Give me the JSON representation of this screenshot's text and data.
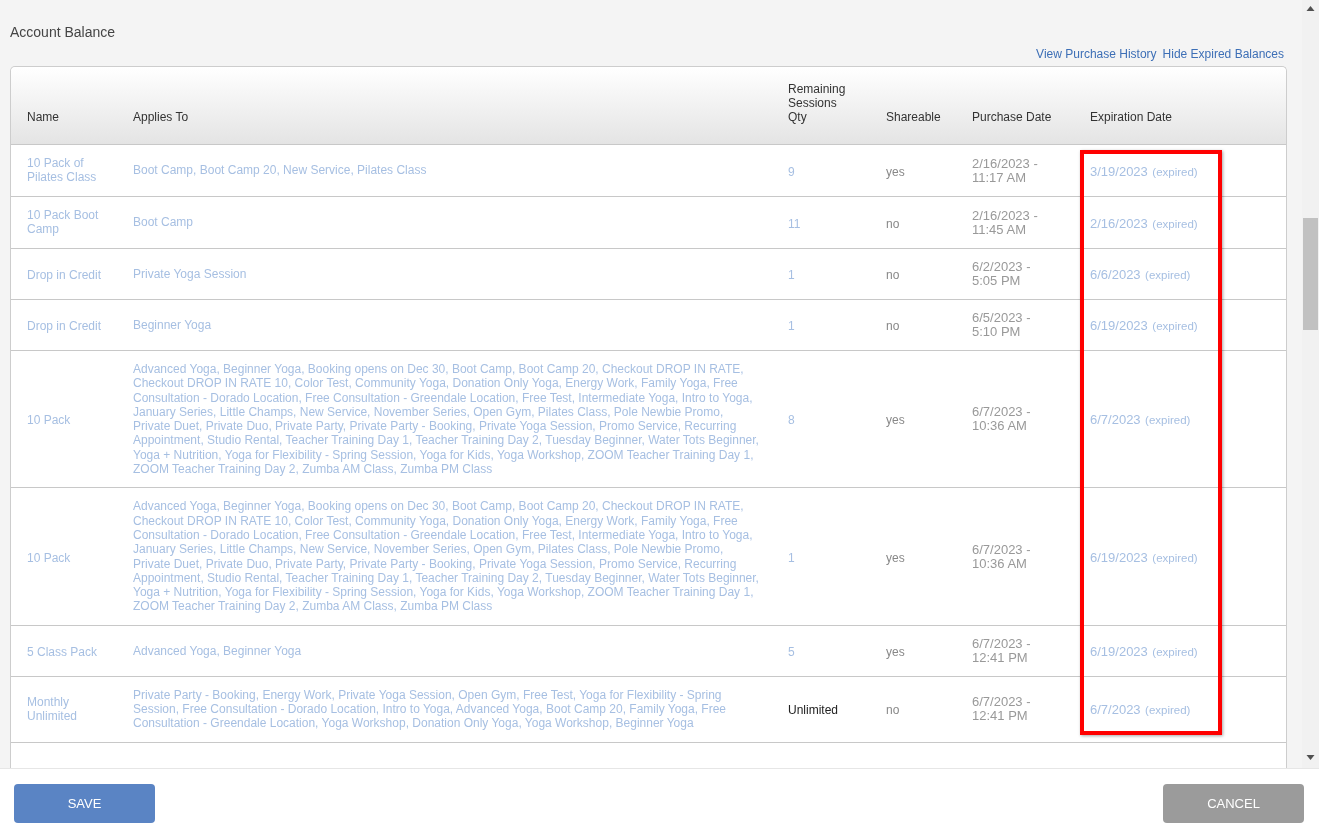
{
  "section": {
    "title": "Account Balance",
    "links": [
      "View Purchase History",
      "Hide Expired Balances"
    ]
  },
  "table": {
    "columns": [
      "Name",
      "Applies To",
      "Remaining Sessions Qty",
      "Shareable",
      "Purchase Date",
      "Expiration Date"
    ],
    "expiration_highlight": true,
    "rows": [
      {
        "name": "10 Pack of Pilates Class",
        "applies_to": "Boot Camp, Boot Camp 20, New Service, Pilates Class",
        "remaining": "9",
        "remaining_linked": true,
        "shareable": "yes",
        "purchase_date": "2/16/2023 - 11:17 AM",
        "expiration_date": "3/19/2023",
        "expiration_note": "(expired)"
      },
      {
        "name": "10 Pack Boot Camp",
        "applies_to": "Boot Camp",
        "remaining": "11",
        "remaining_linked": true,
        "shareable": "no",
        "purchase_date": "2/16/2023 - 11:45 AM",
        "expiration_date": "2/16/2023",
        "expiration_note": "(expired)"
      },
      {
        "name": "Drop in Credit",
        "applies_to": "Private Yoga Session",
        "remaining": "1",
        "remaining_linked": true,
        "shareable": "no",
        "purchase_date": "6/2/2023 - 5:05 PM",
        "expiration_date": "6/6/2023",
        "expiration_note": "(expired)"
      },
      {
        "name": "Drop in Credit",
        "applies_to": "Beginner Yoga",
        "remaining": "1",
        "remaining_linked": true,
        "shareable": "no",
        "purchase_date": "6/5/2023 - 5:10 PM",
        "expiration_date": "6/19/2023",
        "expiration_note": "(expired)"
      },
      {
        "name": "10 Pack",
        "applies_to": "Advanced Yoga, Beginner Yoga, Booking opens on Dec 30, Boot Camp, Boot Camp 20, Checkout DROP IN RATE, Checkout DROP IN RATE 10, Color Test, Community Yoga, Donation Only Yoga, Energy Work, Family Yoga, Free Consultation - Dorado Location, Free Consultation - Greendale Location, Free Test, Intermediate Yoga, Intro to Yoga, January Series, Little Champs, New Service, November Series, Open Gym, Pilates Class, Pole Newbie Promo, Private Duet, Private Duo, Private Party, Private Party - Booking, Private Yoga Session, Promo Service, Recurring Appointment, Studio Rental, Teacher Training Day 1, Teacher Training Day 2, Tuesday Beginner, Water Tots Beginner, Yoga + Nutrition, Yoga for Flexibility - Spring Session, Yoga for Kids, Yoga Workshop, ZOOM Teacher Training Day 1, ZOOM Teacher Training Day 2, Zumba AM Class, Zumba PM Class",
        "remaining": "8",
        "remaining_linked": true,
        "shareable": "yes",
        "purchase_date": "6/7/2023 - 10:36 AM",
        "expiration_date": "6/7/2023",
        "expiration_note": "(expired)"
      },
      {
        "name": "10 Pack",
        "applies_to": "Advanced Yoga, Beginner Yoga, Booking opens on Dec 30, Boot Camp, Boot Camp 20, Checkout DROP IN RATE, Checkout DROP IN RATE 10, Color Test, Community Yoga, Donation Only Yoga, Energy Work, Family Yoga, Free Consultation - Dorado Location, Free Consultation - Greendale Location, Free Test, Intermediate Yoga, Intro to Yoga, January Series, Little Champs, New Service, November Series, Open Gym, Pilates Class, Pole Newbie Promo, Private Duet, Private Duo, Private Party, Private Party - Booking, Private Yoga Session, Promo Service, Recurring Appointment, Studio Rental, Teacher Training Day 1, Teacher Training Day 2, Tuesday Beginner, Water Tots Beginner, Yoga + Nutrition, Yoga for Flexibility - Spring Session, Yoga for Kids, Yoga Workshop, ZOOM Teacher Training Day 1, ZOOM Teacher Training Day 2, Zumba AM Class, Zumba PM Class",
        "remaining": "1",
        "remaining_linked": true,
        "shareable": "yes",
        "purchase_date": "6/7/2023 - 10:36 AM",
        "expiration_date": "6/19/2023",
        "expiration_note": "(expired)"
      },
      {
        "name": "5 Class Pack",
        "applies_to": "Advanced Yoga, Beginner Yoga",
        "remaining": "5",
        "remaining_linked": true,
        "shareable": "yes",
        "purchase_date": "6/7/2023 - 12:41 PM",
        "expiration_date": "6/19/2023",
        "expiration_note": "(expired)"
      },
      {
        "name": "Monthly Unlimited",
        "applies_to": "Private Party - Booking, Energy Work, Private Yoga Session, Open Gym, Free Test, Yoga for Flexibility - Spring Session, Free Consultation - Dorado Location, Intro to Yoga, Advanced Yoga, Boot Camp 20, Family Yoga, Free Consultation - Greendale Location, Yoga Workshop, Donation Only Yoga, Yoga Workshop, Beginner Yoga",
        "remaining": "Unlimited",
        "remaining_linked": false,
        "shareable": "no",
        "purchase_date": "6/7/2023 - 12:41 PM",
        "expiration_date": "6/7/2023",
        "expiration_note": "(expired)"
      }
    ]
  },
  "footer": {
    "buttons": [
      {
        "label": "SAVE",
        "kind": "primary"
      },
      {
        "label": "CANCEL",
        "kind": "secondary"
      }
    ]
  }
}
